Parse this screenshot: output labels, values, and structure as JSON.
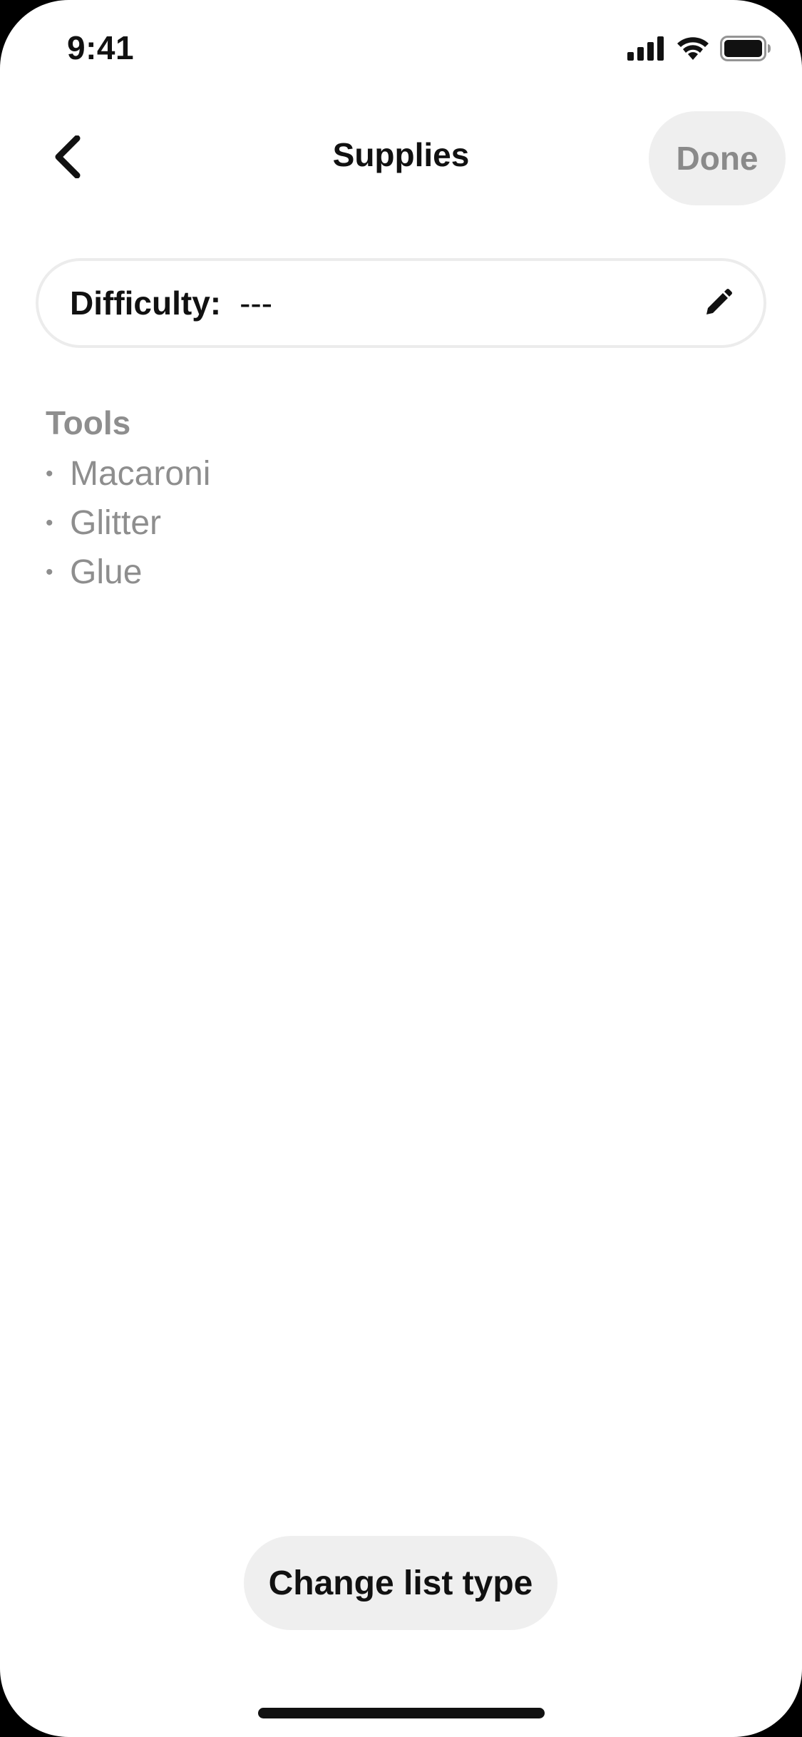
{
  "status_bar": {
    "time": "9:41",
    "icons": [
      "cellular-signal-icon",
      "wifi-icon",
      "battery-icon"
    ]
  },
  "header": {
    "back_icon": "chevron-left-icon",
    "title": "Supplies",
    "done_label": "Done"
  },
  "difficulty": {
    "label": "Difficulty:",
    "value": "---",
    "edit_icon": "pencil-icon"
  },
  "tools": {
    "heading": "Tools",
    "items": [
      {
        "bullet": "•",
        "label": "Macaroni"
      },
      {
        "bullet": "•",
        "label": "Glitter"
      },
      {
        "bullet": "•",
        "label": "Glue"
      }
    ]
  },
  "footer": {
    "change_list_type_label": "Change list type"
  },
  "colors": {
    "background": "#ffffff",
    "primary_text": "#111111",
    "muted_text": "#8e8e8e",
    "button_fill": "#efefef",
    "field_border": "#ececec"
  }
}
